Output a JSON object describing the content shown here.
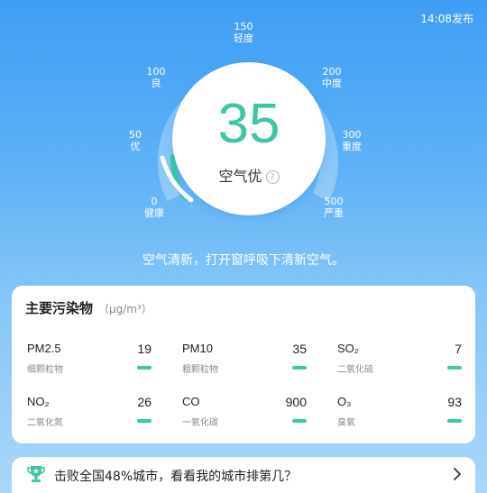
{
  "header": {
    "publish_time": "14:08发布"
  },
  "gauge": {
    "aqi": "35",
    "level": "空气优",
    "help": "?",
    "ticks": [
      {
        "value": "0",
        "label": "健康"
      },
      {
        "value": "50",
        "label": "优"
      },
      {
        "value": "100",
        "label": "良"
      },
      {
        "value": "150",
        "label": "轻度"
      },
      {
        "value": "200",
        "label": "中度"
      },
      {
        "value": "300",
        "label": "重度"
      },
      {
        "value": "500",
        "label": "严重"
      }
    ]
  },
  "advice": "空气清新，打开窗呼吸下清新空气。",
  "pollutants": {
    "title": "主要污染物",
    "unit": "（μg/m³）",
    "items": [
      {
        "name": "PM2.5",
        "desc": "细颗粒物",
        "value": "19"
      },
      {
        "name": "PM10",
        "desc": "粗颗粒物",
        "value": "35"
      },
      {
        "name": "SO₂",
        "desc": "二氧化硫",
        "value": "7"
      },
      {
        "name": "NO₂",
        "desc": "二氧化氮",
        "value": "26"
      },
      {
        "name": "CO",
        "desc": "一氧化碳",
        "value": "900"
      },
      {
        "name": "O₃",
        "desc": "臭氧",
        "value": "93"
      }
    ]
  },
  "ranking": {
    "text": "击败全国48%城市，看看我的城市排第几？"
  },
  "colors": {
    "good": "#3ec6a5",
    "sky": "#4aa6f5"
  },
  "icons": {
    "ranking": "trophy-icon",
    "more": "chevron-right-icon"
  }
}
